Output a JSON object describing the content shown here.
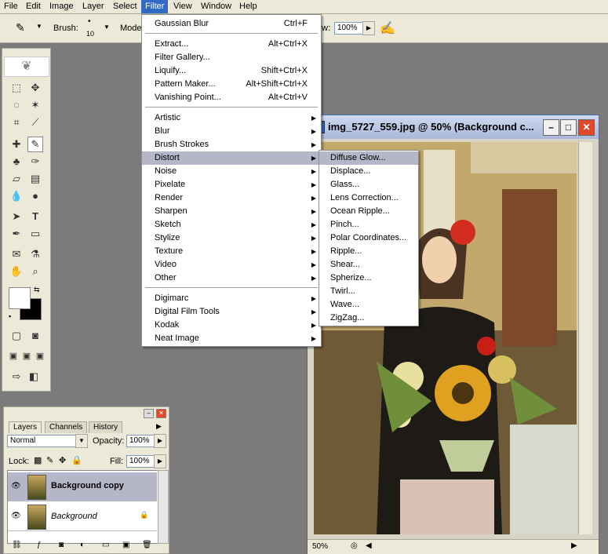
{
  "menubar": {
    "items": [
      "File",
      "Edit",
      "Image",
      "Layer",
      "Select",
      "Filter",
      "View",
      "Window",
      "Help"
    ],
    "active": "Filter"
  },
  "options": {
    "brush_label": "Brush:",
    "brush_size": "10",
    "mode_label": "Mode",
    "flow_label": "w:",
    "flow_value": "100%"
  },
  "filter_menu": {
    "items": [
      {
        "label": "Gaussian Blur",
        "shortcut": "Ctrl+F"
      },
      {
        "label": "Extract...",
        "shortcut": "Alt+Ctrl+X"
      },
      {
        "label": "Filter Gallery...",
        "shortcut": ""
      },
      {
        "label": "Liquify...",
        "shortcut": "Shift+Ctrl+X"
      },
      {
        "label": "Pattern Maker...",
        "shortcut": "Alt+Shift+Ctrl+X"
      },
      {
        "label": "Vanishing Point...",
        "shortcut": "Alt+Ctrl+V"
      },
      {
        "label": "Artistic",
        "shortcut": ""
      },
      {
        "label": "Blur",
        "shortcut": ""
      },
      {
        "label": "Brush Strokes",
        "shortcut": ""
      },
      {
        "label": "Distort",
        "shortcut": ""
      },
      {
        "label": "Noise",
        "shortcut": ""
      },
      {
        "label": "Pixelate",
        "shortcut": ""
      },
      {
        "label": "Render",
        "shortcut": ""
      },
      {
        "label": "Sharpen",
        "shortcut": ""
      },
      {
        "label": "Sketch",
        "shortcut": ""
      },
      {
        "label": "Stylize",
        "shortcut": ""
      },
      {
        "label": "Texture",
        "shortcut": ""
      },
      {
        "label": "Video",
        "shortcut": ""
      },
      {
        "label": "Other",
        "shortcut": ""
      },
      {
        "label": "Digimarc",
        "shortcut": ""
      },
      {
        "label": "Digital Film Tools",
        "shortcut": ""
      },
      {
        "label": "Kodak",
        "shortcut": ""
      },
      {
        "label": "Neat Image",
        "shortcut": ""
      }
    ],
    "highlighted": "Distort"
  },
  "distort_submenu": {
    "items": [
      "Diffuse Glow...",
      "Displace...",
      "Glass...",
      "Lens Correction...",
      "Ocean Ripple...",
      "Pinch...",
      "Polar Coordinates...",
      "Ripple...",
      "Shear...",
      "Spherize...",
      "Twirl...",
      "Wave...",
      "ZigZag..."
    ],
    "highlighted": "Diffuse Glow..."
  },
  "image_window": {
    "title": "img_5727_559.jpg @ 50% (Background c...",
    "zoom": "50%"
  },
  "layers_panel": {
    "tabs": [
      "Layers",
      "Channels",
      "History"
    ],
    "active_tab": "Layers",
    "blend_mode": "Normal",
    "opacity_label": "Opacity:",
    "opacity_value": "100%",
    "lock_label": "Lock:",
    "fill_label": "Fill:",
    "fill_value": "100%",
    "layers": [
      {
        "name": "Background copy",
        "selected": true
      },
      {
        "name": "Background",
        "selected": false
      }
    ]
  },
  "colors": {
    "menu_highlight": "#b5b6c8",
    "menubar_active": "#316ac5",
    "chrome": "#ece9d8",
    "workspace": "#7b7b7b"
  }
}
